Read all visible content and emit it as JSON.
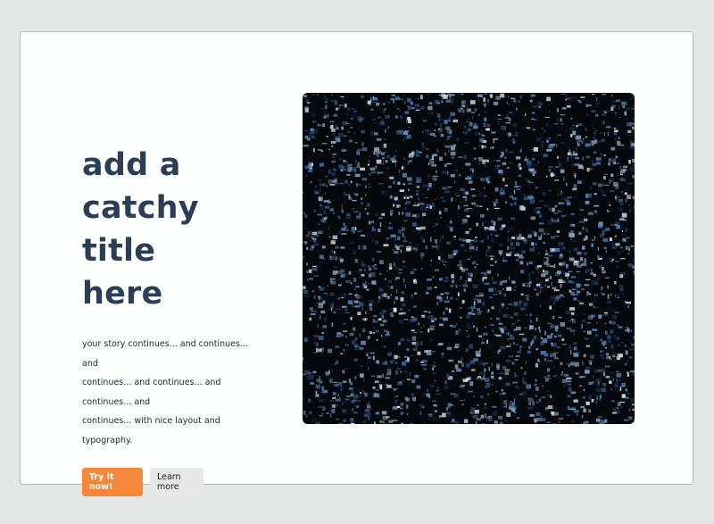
{
  "hero": {
    "title_line_1": "add a",
    "title_line_2": "catchy title",
    "title_line_3": "here",
    "body_line_1": "your story continues... and continues... and",
    "body_line_2": "continues... and continues... and continues... and",
    "body_line_3": "continues... with nice layout and typography.",
    "primary_button": "Try it now!",
    "secondary_button": "Learn more"
  },
  "colors": {
    "page_background": "#e5e6e6",
    "card_background": "#fdfefe",
    "title": "#2c3e55",
    "primary_button": "#f5883b",
    "secondary_button": "#e7e7e7",
    "image_base": "#05080c",
    "image_accent": "#2f5f8e"
  },
  "image": {
    "icon": "abstract-noise-image"
  }
}
